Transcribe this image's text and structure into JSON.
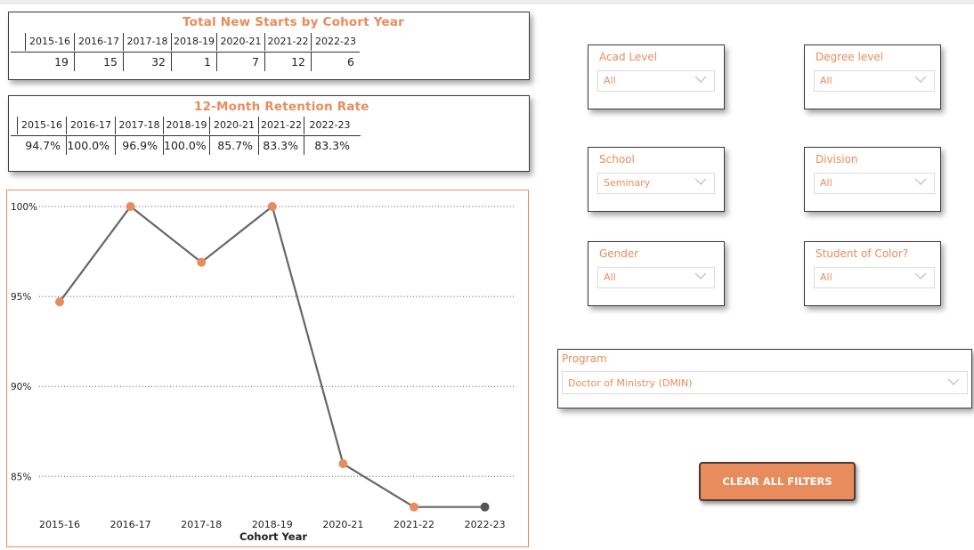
{
  "tables": {
    "new_starts": {
      "title": "Total New Starts by Cohort Year",
      "headers": [
        "2015-16",
        "2016-17",
        "2017-18",
        "2018-19",
        "2020-21",
        "2021-22",
        "2022-23"
      ],
      "values": [
        "19",
        "15",
        "32",
        "1",
        "7",
        "12",
        "6"
      ]
    },
    "retention": {
      "title": "12-Month Retention Rate",
      "headers": [
        "2015-16",
        "2016-17",
        "2017-18",
        "2018-19",
        "2020-21",
        "2021-22",
        "2022-23"
      ],
      "values": [
        "94.7%",
        "100.0%",
        "96.9%",
        "100.0%",
        "85.7%",
        "83.3%",
        "83.3%"
      ]
    }
  },
  "filters": {
    "acad_level": {
      "label": "Acad Level",
      "value": "All"
    },
    "degree_level": {
      "label": "Degree level",
      "value": "All"
    },
    "school": {
      "label": "School",
      "value": "Seminary"
    },
    "division": {
      "label": "Division",
      "value": "All"
    },
    "gender": {
      "label": "Gender",
      "value": "All"
    },
    "student_of_color": {
      "label": "Student of Color?",
      "value": "All"
    },
    "program": {
      "label": "Program",
      "value": "Doctor of Ministry (DMIN)"
    }
  },
  "buttons": {
    "clear_all": "CLEAR ALL FILTERS"
  },
  "colors": {
    "accent": "#e88c5d",
    "line": "#666666",
    "last_marker": "#555555"
  },
  "chart_data": {
    "type": "line",
    "x": [
      "2015-16",
      "2016-17",
      "2017-18",
      "2018-19",
      "2020-21",
      "2021-22",
      "2022-23"
    ],
    "series": [
      {
        "values": [
          94.7,
          100.0,
          96.9,
          100.0,
          85.7,
          83.3,
          83.3
        ]
      }
    ],
    "xlabel": "Cohort Year",
    "ylabel": "",
    "yticks": [
      "100%",
      "95%",
      "90%",
      "85%"
    ],
    "ylim": [
      81.3,
      100
    ],
    "grid": true
  }
}
